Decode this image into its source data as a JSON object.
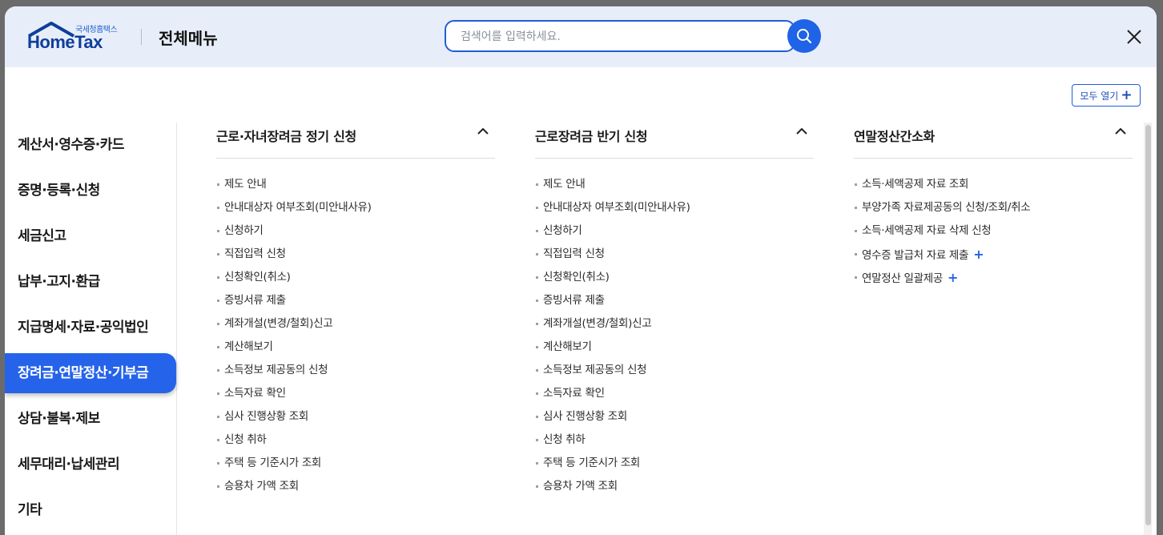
{
  "header": {
    "logo_small": "국세청홈택스",
    "logo_main": "HomeTax",
    "menu_title": "전체메뉴",
    "search_placeholder": "검색어를 입력하세요."
  },
  "toolbar": {
    "open_all_label": "모두 열기",
    "open_all_icon": "plus-icon"
  },
  "colors": {
    "accent": "#2563eb",
    "header_bg": "#e8eef9",
    "logo_blue": "#0f3e9a"
  },
  "sidebar": {
    "items": [
      {
        "label": "계산서·영수증·카드"
      },
      {
        "label": "증명·등록·신청"
      },
      {
        "label": "세금신고"
      },
      {
        "label": "납부·고지·환급"
      },
      {
        "label": "지급명세·자료·공익법인"
      },
      {
        "label": "장려금·연말정산·기부금",
        "active": true
      },
      {
        "label": "상담·불복·제보"
      },
      {
        "label": "세무대리·납세관리"
      },
      {
        "label": "기타"
      }
    ]
  },
  "columns": [
    {
      "title": "근로·자녀장려금 정기 신청",
      "items": [
        {
          "label": "제도 안내"
        },
        {
          "label": "안내대상자 여부조회(미안내사유)"
        },
        {
          "label": "신청하기"
        },
        {
          "label": "직접입력 신청"
        },
        {
          "label": "신청확인(취소)"
        },
        {
          "label": "증빙서류 제출"
        },
        {
          "label": "계좌개설(변경/철회)신고"
        },
        {
          "label": "계산해보기"
        },
        {
          "label": "소득정보 제공동의 신청"
        },
        {
          "label": "소득자료 확인"
        },
        {
          "label": "심사 진행상황 조회"
        },
        {
          "label": "신청 취하"
        },
        {
          "label": "주택 등 기준시가 조회"
        },
        {
          "label": "승용차 가액 조회"
        }
      ]
    },
    {
      "title": "근로장려금 반기 신청",
      "items": [
        {
          "label": "제도 안내"
        },
        {
          "label": "안내대상자 여부조회(미안내사유)"
        },
        {
          "label": "신청하기"
        },
        {
          "label": "직접입력 신청"
        },
        {
          "label": "신청확인(취소)"
        },
        {
          "label": "증빙서류 제출"
        },
        {
          "label": "계좌개설(변경/철회)신고"
        },
        {
          "label": "계산해보기"
        },
        {
          "label": "소득정보 제공동의 신청"
        },
        {
          "label": "소득자료 확인"
        },
        {
          "label": "심사 진행상황 조회"
        },
        {
          "label": "신청 취하"
        },
        {
          "label": "주택 등 기준시가 조회"
        },
        {
          "label": "승용차 가액 조회"
        }
      ]
    },
    {
      "title": "연말정산간소화",
      "items": [
        {
          "label": "소득·세액공제 자료 조회"
        },
        {
          "label": "부양가족 자료제공동의 신청/조회/취소"
        },
        {
          "label": "소득·세액공제 자료 삭제 신청"
        },
        {
          "label": "영수증 발급처 자료 제출",
          "expandable": true
        },
        {
          "label": "연말정산 일괄제공",
          "expandable": true
        }
      ]
    }
  ]
}
